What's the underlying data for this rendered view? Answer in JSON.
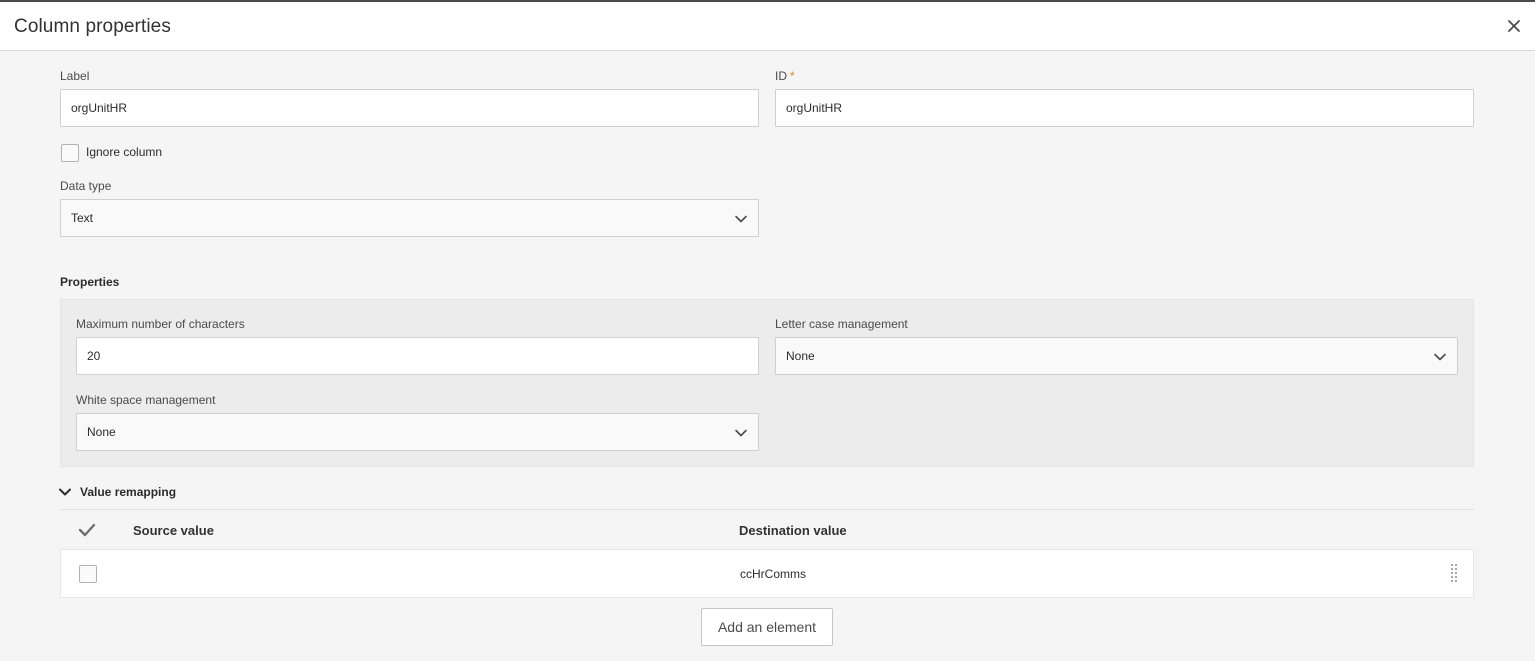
{
  "dialog": {
    "title": "Column properties",
    "close_icon": "close-icon"
  },
  "label_field": {
    "label": "Label",
    "value": "orgUnitHR"
  },
  "id_field": {
    "label": "ID",
    "required_marker": "*",
    "value": "orgUnitHR"
  },
  "ignore_column": {
    "label": "Ignore column",
    "checked": false
  },
  "data_type": {
    "label": "Data type",
    "selected": "Text"
  },
  "properties": {
    "title": "Properties",
    "max_chars": {
      "label": "Maximum number of characters",
      "value": "20"
    },
    "letter_case": {
      "label": "Letter case management",
      "selected": "None"
    },
    "white_space": {
      "label": "White space management",
      "selected": "None"
    }
  },
  "value_remapping": {
    "title": "Value remapping",
    "expanded": true,
    "columns": {
      "source": "Source value",
      "destination": "Destination value"
    },
    "rows": [
      {
        "source": "",
        "destination": "ccHrComms",
        "checked": false
      }
    ],
    "add_button": "Add an element"
  },
  "colors": {
    "required": "#e68619",
    "panel_bg": "#ececec",
    "page_bg": "#f5f5f5"
  }
}
